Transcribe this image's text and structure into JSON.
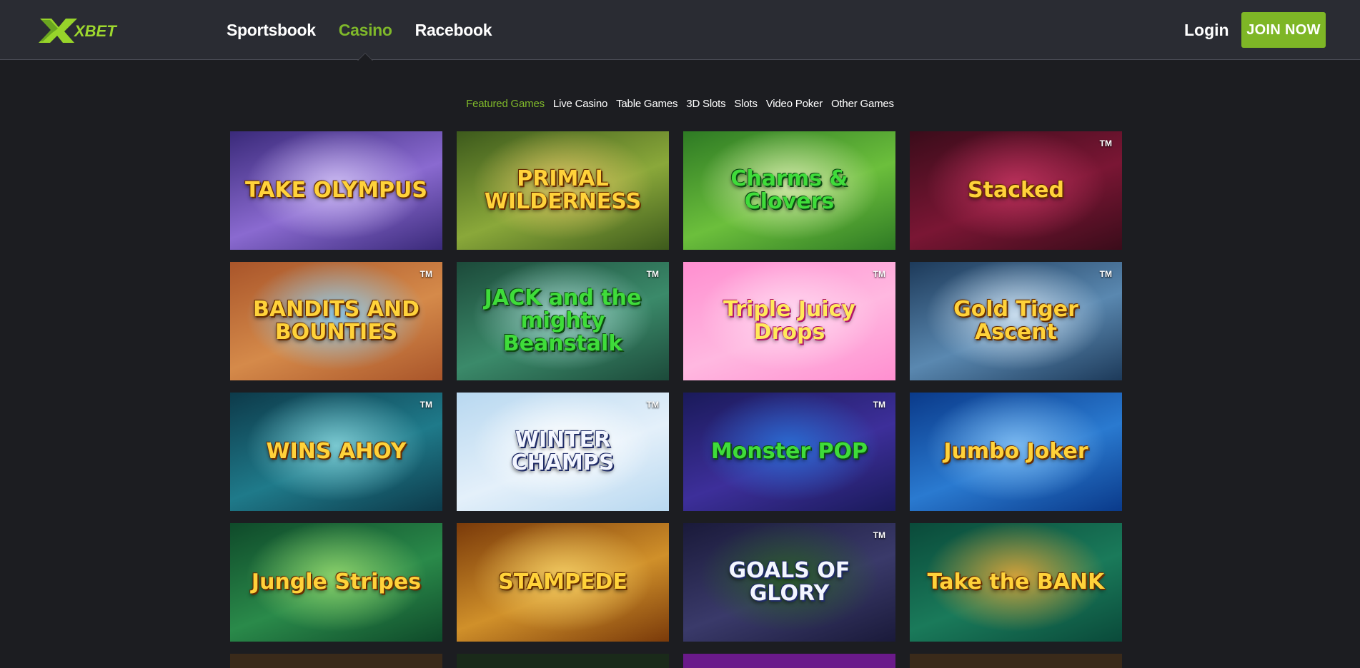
{
  "header": {
    "logo_text": "XBET",
    "nav": [
      {
        "label": "Sportsbook",
        "active": false
      },
      {
        "label": "Casino",
        "active": true
      },
      {
        "label": "Racebook",
        "active": false
      }
    ],
    "login_label": "Login",
    "join_label": "JOIN NOW",
    "accent_color": "#7eb626"
  },
  "categories": [
    {
      "label": "Featured Games",
      "active": true
    },
    {
      "label": "Live Casino",
      "active": false
    },
    {
      "label": "Table Games",
      "active": false
    },
    {
      "label": "3D Slots",
      "active": false
    },
    {
      "label": "Slots",
      "active": false
    },
    {
      "label": "Video Poker",
      "active": false
    },
    {
      "label": "Other Games",
      "active": false
    }
  ],
  "games": [
    {
      "title": "TAKE OLYMPUS",
      "tm": "",
      "style": "gold",
      "bg": [
        "#3a2a7a",
        "#8a6ad0",
        "#c9b8f0"
      ]
    },
    {
      "title": "PRIMAL WILDERNESS",
      "tm": "",
      "style": "gold",
      "bg": [
        "#3d5a1c",
        "#8aa83a",
        "#d8c060"
      ]
    },
    {
      "title": "Charms & Clovers",
      "tm": "",
      "style": "green",
      "bg": [
        "#2e7a24",
        "#6cbf3c",
        "#cfe6a8"
      ]
    },
    {
      "title": "Stacked",
      "tm": "TM",
      "style": "gold",
      "bg": [
        "#3a0c1a",
        "#7a1634",
        "#b8305a"
      ]
    },
    {
      "title": "BANDITS AND BOUNTIES",
      "tm": "TM",
      "style": "gold",
      "bg": [
        "#a9552a",
        "#d58a4a",
        "#8fc8e8"
      ]
    },
    {
      "title": "JACK and the mighty Beanstalk",
      "tm": "TM",
      "style": "green",
      "bg": [
        "#1c4a3a",
        "#3b8a6a",
        "#9fd0c8"
      ]
    },
    {
      "title": "Triple Juicy Drops",
      "tm": "TM",
      "style": "pink",
      "bg": [
        "#ff8fd0",
        "#ffb8e0",
        "#ffd8f0"
      ]
    },
    {
      "title": "Gold Tiger Ascent",
      "tm": "TM",
      "style": "gold",
      "bg": [
        "#1d3a5a",
        "#5a88b0",
        "#c8dced"
      ]
    },
    {
      "title": "WINS AHOY",
      "tm": "TM",
      "style": "gold",
      "bg": [
        "#0d3a4a",
        "#1f7a8a",
        "#7ac8d0"
      ]
    },
    {
      "title": "WINTER CHAMPS",
      "tm": "TM",
      "style": "white",
      "bg": [
        "#b8d8f0",
        "#e4f0fa",
        "#ffffff"
      ]
    },
    {
      "title": "Monster POP",
      "tm": "TM",
      "style": "green",
      "bg": [
        "#1a1a5a",
        "#3d2f9a",
        "#2a6ad0"
      ]
    },
    {
      "title": "Jumbo Joker",
      "tm": "",
      "style": "gold",
      "bg": [
        "#0a3a8a",
        "#2a7ad0",
        "#7ab8f0"
      ]
    },
    {
      "title": "Jungle Stripes",
      "tm": "",
      "style": "gold",
      "bg": [
        "#0f4a2a",
        "#2a8a4a",
        "#8ad06a"
      ]
    },
    {
      "title": "STAMPEDE",
      "tm": "",
      "style": "gold",
      "bg": [
        "#7a3a0a",
        "#d0902a",
        "#f0c860"
      ]
    },
    {
      "title": "GOALS OF GLORY",
      "tm": "TM",
      "style": "white",
      "bg": [
        "#1a1a3a",
        "#3a3a6a",
        "#2a5a2a"
      ]
    },
    {
      "title": "Take the BANK",
      "tm": "",
      "style": "gold",
      "bg": [
        "#0a4a3a",
        "#1a7a5a",
        "#d0a03a"
      ]
    }
  ],
  "partial_row_colors": [
    "#3a2a1a",
    "#1a2a1a",
    "#6a1a8a",
    "#3a2a1a"
  ]
}
